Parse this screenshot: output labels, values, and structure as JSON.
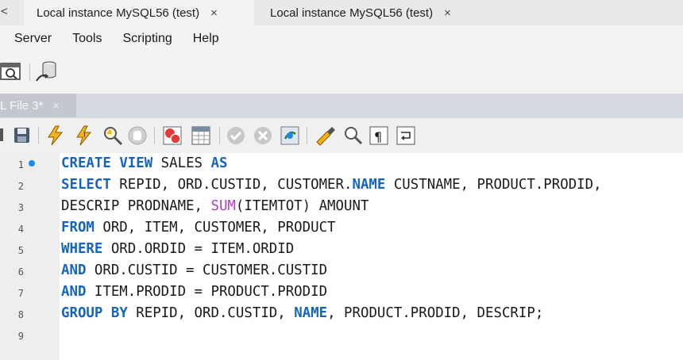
{
  "tabs": [
    {
      "label": "Local instance MySQL56 (test)",
      "close": "×"
    },
    {
      "label": "Local instance MySQL56 (test)",
      "close": "×"
    }
  ],
  "left_close": "<",
  "menu": [
    "Server",
    "Tools",
    "Scripting",
    "Help"
  ],
  "editor_tab": {
    "label": "L File 3*",
    "close": "×"
  },
  "line_numbers": [
    "1",
    "2",
    "3",
    "4",
    "5",
    "6",
    "7",
    "8",
    "9"
  ],
  "code_lines": [
    [
      {
        "t": "CREATE",
        "k": "kw"
      },
      {
        "t": " "
      },
      {
        "t": "VIEW",
        "k": "kw"
      },
      {
        "t": " SALES "
      },
      {
        "t": "AS",
        "k": "kw"
      }
    ],
    [
      {
        "t": "SELECT",
        "k": "kw"
      },
      {
        "t": " REPID, ORD.CUSTID, CUSTOMER."
      },
      {
        "t": "NAME",
        "k": "kw"
      },
      {
        "t": " CUSTNAME, PRODUCT.PRODID,"
      }
    ],
    [
      {
        "t": "DESCRIP PRODNAME, "
      },
      {
        "t": "SUM",
        "k": "fn"
      },
      {
        "t": "(ITEMTOT) AMOUNT"
      }
    ],
    [
      {
        "t": "FROM",
        "k": "kw"
      },
      {
        "t": " ORD, ITEM, CUSTOMER, PRODUCT"
      }
    ],
    [
      {
        "t": "WHERE",
        "k": "kw"
      },
      {
        "t": " ORD.ORDID = ITEM.ORDID"
      }
    ],
    [
      {
        "t": "AND",
        "k": "kw"
      },
      {
        "t": " ORD.CUSTID = CUSTOMER.CUSTID"
      }
    ],
    [
      {
        "t": "AND",
        "k": "kw"
      },
      {
        "t": " ITEM.PRODID = PRODUCT.PRODID"
      }
    ],
    [
      {
        "t": "GROUP",
        "k": "kw"
      },
      {
        "t": " "
      },
      {
        "t": "BY",
        "k": "kw"
      },
      {
        "t": " REPID, ORD.CUSTID, "
      },
      {
        "t": "NAME",
        "k": "kw"
      },
      {
        "t": ", PRODUCT.PRODID, DESCRIP;"
      }
    ],
    []
  ],
  "icons": [
    "query-inspector-icon",
    "database-connect-icon",
    "save-icon",
    "execute-icon",
    "execute-current-icon",
    "explain-icon",
    "stop-icon",
    "toggle-continue-icon",
    "toggle-result-icon",
    "commit-icon",
    "rollback-icon",
    "autocommit-icon",
    "beautify-icon",
    "find-icon",
    "invisible-chars-icon",
    "wrap-icon"
  ]
}
